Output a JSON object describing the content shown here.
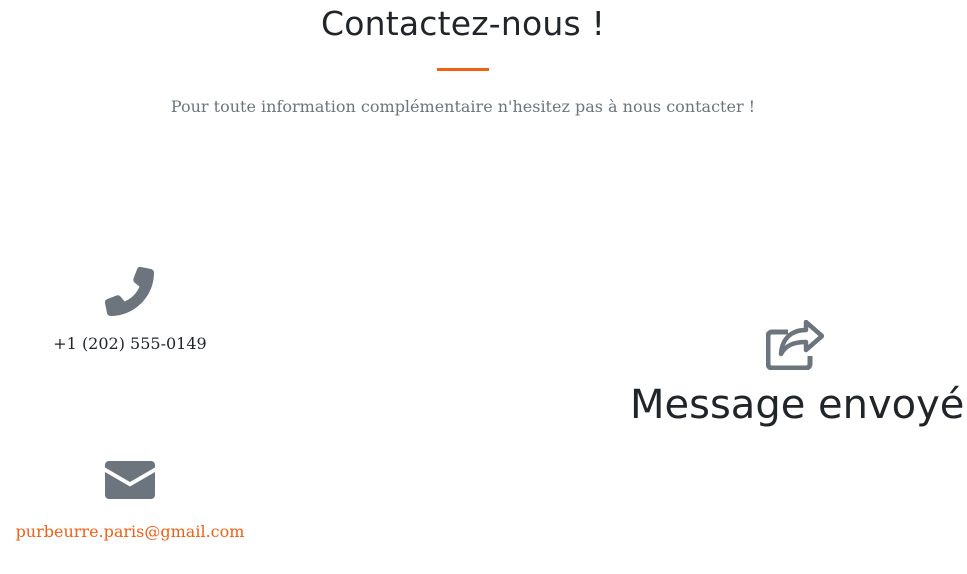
{
  "header": {
    "title": "Contactez-nous !",
    "subtitle": "Pour toute information complémentaire n'hesitez pas à nous contacter !",
    "accent_color": "#f05f12"
  },
  "contact": {
    "phone_icon": "phone-icon",
    "phone": "+1 (202) 555-0149",
    "mail_icon": "envelope-icon",
    "email": "purbeurre.paris@gmail.com"
  },
  "status": {
    "icon": "share-icon",
    "message": "Message envoyé"
  },
  "colors": {
    "icon_gray": "#6c757d",
    "text_dark": "#212529",
    "link_orange": "#f05f12"
  }
}
